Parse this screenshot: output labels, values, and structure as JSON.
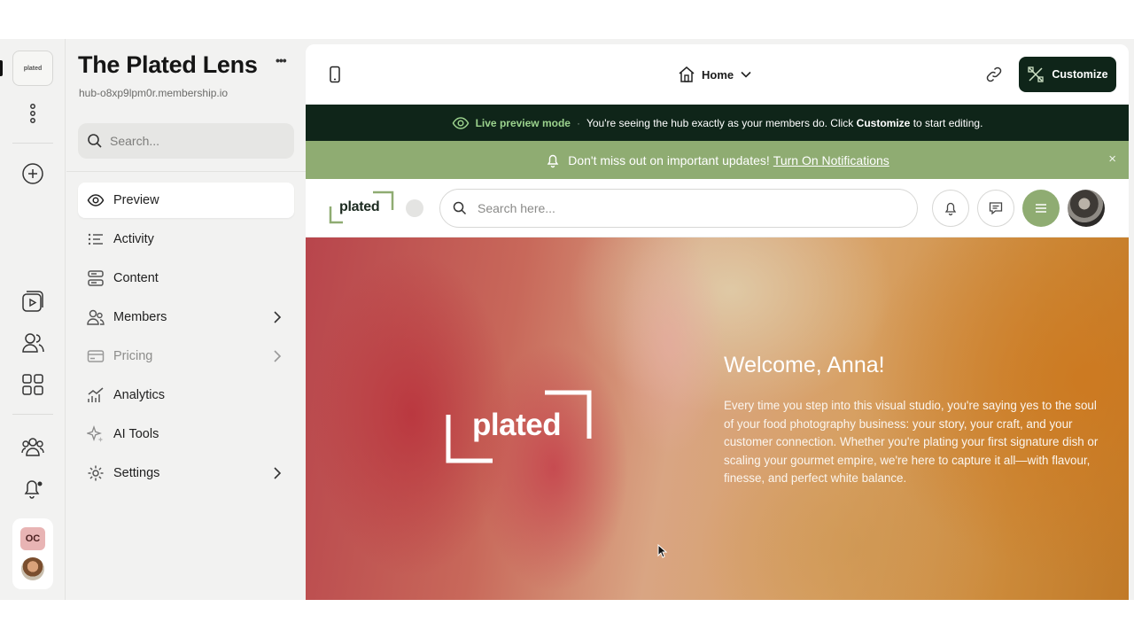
{
  "app": {
    "title": "The Plated Lens",
    "subdomain": "hub-o8xp9lpm0r.membership.io",
    "search_placeholder": "Search...",
    "rail_logo_text": "plated",
    "account_initials": "OC"
  },
  "nav": {
    "items": [
      {
        "label": "Preview",
        "icon": "eye-icon",
        "active": true
      },
      {
        "label": "Activity",
        "icon": "activity-list-icon"
      },
      {
        "label": "Content",
        "icon": "content-stack-icon"
      },
      {
        "label": "Members",
        "icon": "members-icon",
        "chevron": true
      },
      {
        "label": "Pricing",
        "icon": "credit-card-icon",
        "chevron": true,
        "dimmed": true
      },
      {
        "label": "Analytics",
        "icon": "analytics-icon"
      },
      {
        "label": "AI Tools",
        "icon": "sparkle-icon"
      },
      {
        "label": "Settings",
        "icon": "gear-icon",
        "chevron": true
      }
    ]
  },
  "toolbar": {
    "page_selector": "Home",
    "customize_label": "Customize"
  },
  "live_banner": {
    "mode_label": "Live preview mode",
    "separator": "·",
    "text_before": "You're seeing the hub exactly as your members do. Click",
    "emphasis": "Customize",
    "text_after": "to start editing."
  },
  "notification_banner": {
    "text": "Don't miss out on important updates!",
    "link": "Turn On Notifications",
    "close": "×"
  },
  "hub": {
    "logo_text": "plated",
    "search_placeholder": "Search here..."
  },
  "hero": {
    "logo_text": "plated",
    "welcome": "Welcome, Anna!",
    "paragraph": "Every time you step into this visual studio, you're saying yes to the soul of your food photography business: your story, your craft, and your customer connection. Whether you're plating your first signature dish or scaling your gourmet empire, we're here to capture it all—with flavour, finesse, and perfect white balance."
  },
  "colors": {
    "dark_green": "#0f2519",
    "sage_green": "#8fac72",
    "live_label_green": "#9bd28d"
  }
}
